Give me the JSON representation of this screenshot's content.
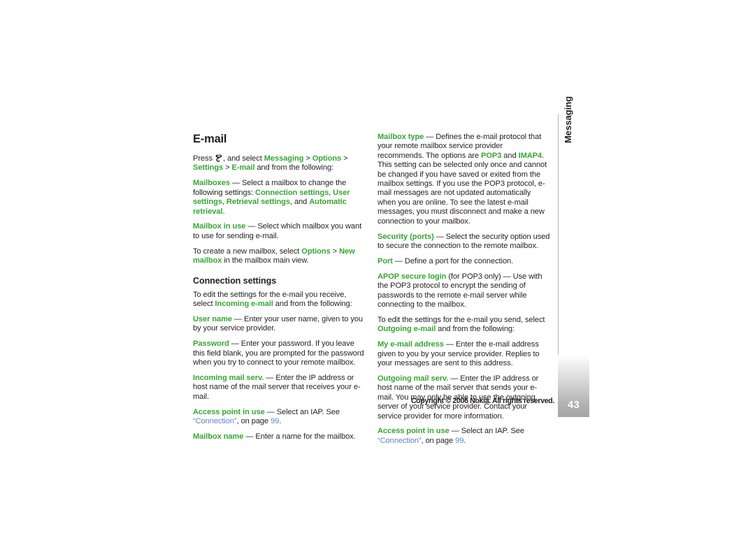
{
  "document": {
    "type": "user-guide-page",
    "page_number": "43",
    "chapter": "Messaging",
    "copyright": "Copyright © 2006 Nokia. All rights reserved.",
    "colors": {
      "term_green": "#36a635",
      "link_blue": "#5d7fd0",
      "body_text": "#231f20",
      "rail_line": "#b4b4b8"
    }
  },
  "left_column": {
    "title": "E-mail",
    "blocks": [
      {
        "id": "press-intro",
        "kind": "paragraph",
        "runs": [
          {
            "t": "plain",
            "text": "Press "
          },
          {
            "t": "icon",
            "text": "menu-key-icon"
          },
          {
            "t": "plain",
            "text": ", and select "
          },
          {
            "t": "term",
            "text": "Messaging"
          },
          {
            "t": "plain",
            "text": " > "
          },
          {
            "t": "term",
            "text": "Options"
          },
          {
            "t": "plain",
            "text": " > "
          },
          {
            "t": "term",
            "text": "Settings"
          },
          {
            "t": "plain",
            "text": " > "
          },
          {
            "t": "term",
            "text": "E-mail"
          },
          {
            "t": "plain",
            "text": " and from the following:"
          }
        ]
      },
      {
        "id": "mailboxes",
        "kind": "paragraph",
        "runs": [
          {
            "t": "term",
            "text": "Mailboxes"
          },
          {
            "t": "plain",
            "text": " — Select a mailbox to change the following settings: "
          },
          {
            "t": "term",
            "text": "Connection settings"
          },
          {
            "t": "plain",
            "text": ", "
          },
          {
            "t": "term",
            "text": "User settings"
          },
          {
            "t": "plain",
            "text": ", "
          },
          {
            "t": "term",
            "text": "Retrieval settings"
          },
          {
            "t": "plain",
            "text": ", and "
          },
          {
            "t": "term",
            "text": "Automatic retrieval"
          },
          {
            "t": "plain",
            "text": "."
          }
        ]
      },
      {
        "id": "mailbox-in-use",
        "kind": "paragraph",
        "runs": [
          {
            "t": "term",
            "text": "Mailbox in use"
          },
          {
            "t": "plain",
            "text": " — Select which mailbox you want to use for sending e-mail."
          }
        ]
      },
      {
        "id": "create-new-mailbox",
        "kind": "paragraph",
        "runs": [
          {
            "t": "plain",
            "text": "To create a new mailbox, select "
          },
          {
            "t": "term",
            "text": "Options"
          },
          {
            "t": "plain",
            "text": " > "
          },
          {
            "t": "term",
            "text": "New mailbox"
          },
          {
            "t": "plain",
            "text": " in the mailbox main view."
          }
        ]
      },
      {
        "id": "connection-settings-heading",
        "kind": "heading",
        "text": "Connection settings"
      },
      {
        "id": "incoming-intro",
        "kind": "paragraph",
        "runs": [
          {
            "t": "plain",
            "text": "To edit the settings for the e-mail you receive, select "
          },
          {
            "t": "term",
            "text": "Incoming e-mail"
          },
          {
            "t": "plain",
            "text": " and from the following:"
          }
        ]
      },
      {
        "id": "user-name",
        "kind": "paragraph",
        "runs": [
          {
            "t": "term",
            "text": "User name"
          },
          {
            "t": "plain",
            "text": " — Enter your user name, given to you by your service provider."
          }
        ]
      },
      {
        "id": "password",
        "kind": "paragraph",
        "runs": [
          {
            "t": "term",
            "text": "Password"
          },
          {
            "t": "plain",
            "text": " — Enter your password. If you leave this field blank, you are prompted for the password when you try to connect to your remote mailbox."
          }
        ]
      },
      {
        "id": "incoming-mail-serv",
        "kind": "paragraph",
        "runs": [
          {
            "t": "term",
            "text": "Incoming mail serv."
          },
          {
            "t": "plain",
            "text": " — Enter the IP address or host name of the mail server that receives your e-mail."
          }
        ]
      },
      {
        "id": "access-point-in-use-left",
        "kind": "paragraph",
        "runs": [
          {
            "t": "term",
            "text": "Access point in use"
          },
          {
            "t": "plain",
            "text": " — Select an IAP. See "
          },
          {
            "t": "link",
            "text": "“Connection”"
          },
          {
            "t": "plain",
            "text": ", on page "
          },
          {
            "t": "link",
            "text": "99"
          },
          {
            "t": "plain",
            "text": "."
          }
        ]
      },
      {
        "id": "mailbox-name",
        "kind": "paragraph",
        "runs": [
          {
            "t": "term",
            "text": "Mailbox name"
          },
          {
            "t": "plain",
            "text": " — Enter a name for the mailbox."
          }
        ]
      }
    ]
  },
  "right_column": {
    "blocks": [
      {
        "id": "mailbox-type",
        "kind": "paragraph",
        "runs": [
          {
            "t": "term",
            "text": "Mailbox type"
          },
          {
            "t": "plain",
            "text": " — Defines the e-mail protocol that your remote mailbox service provider recommends. The options are "
          },
          {
            "t": "term",
            "text": "POP3"
          },
          {
            "t": "plain",
            "text": " and "
          },
          {
            "t": "term",
            "text": "IMAP4"
          },
          {
            "t": "plain",
            "text": ". This setting can be selected only once and cannot be changed if you have saved or exited from the mailbox settings. If you use the POP3 protocol, e-mail messages are not updated automatically when you are online. To see the latest e-mail messages, you must disconnect and make a new connection to your mailbox."
          }
        ]
      },
      {
        "id": "security-ports",
        "kind": "paragraph",
        "runs": [
          {
            "t": "term",
            "text": "Security (ports)"
          },
          {
            "t": "plain",
            "text": " — Select the security option used to secure the connection to the remote mailbox."
          }
        ]
      },
      {
        "id": "port",
        "kind": "paragraph",
        "runs": [
          {
            "t": "term",
            "text": "Port"
          },
          {
            "t": "plain",
            "text": " — Define a port for the connection."
          }
        ]
      },
      {
        "id": "apop-secure-login",
        "kind": "paragraph",
        "runs": [
          {
            "t": "term",
            "text": "APOP secure login"
          },
          {
            "t": "plain",
            "text": " (for POP3 only) — Use with the POP3 protocol to encrypt the sending of passwords to the remote e-mail server while connecting to the mailbox."
          }
        ]
      },
      {
        "id": "outgoing-intro",
        "kind": "paragraph",
        "runs": [
          {
            "t": "plain",
            "text": "To edit the settings for the e-mail you send, select "
          },
          {
            "t": "term",
            "text": "Outgoing e-mail"
          },
          {
            "t": "plain",
            "text": " and from the following:"
          }
        ]
      },
      {
        "id": "my-email-address",
        "kind": "paragraph",
        "runs": [
          {
            "t": "term",
            "text": "My e-mail address"
          },
          {
            "t": "plain",
            "text": " — Enter the e-mail address given to you by your service provider. Replies to your messages are sent to this address."
          }
        ]
      },
      {
        "id": "outgoing-mail-serv",
        "kind": "paragraph",
        "runs": [
          {
            "t": "term",
            "text": "Outgoing mail serv."
          },
          {
            "t": "plain",
            "text": " — Enter the IP address or host name of the mail server that sends your e-mail. You may only be able to use the outgoing server of your service provider. Contact your service provider for more information."
          }
        ]
      },
      {
        "id": "access-point-in-use-right",
        "kind": "paragraph",
        "runs": [
          {
            "t": "term",
            "text": "Access point in use"
          },
          {
            "t": "plain",
            "text": " — Select an IAP. See "
          },
          {
            "t": "link",
            "text": "“Connection”"
          },
          {
            "t": "plain",
            "text": ", on page "
          },
          {
            "t": "link",
            "text": "99"
          },
          {
            "t": "plain",
            "text": "."
          }
        ]
      }
    ]
  }
}
